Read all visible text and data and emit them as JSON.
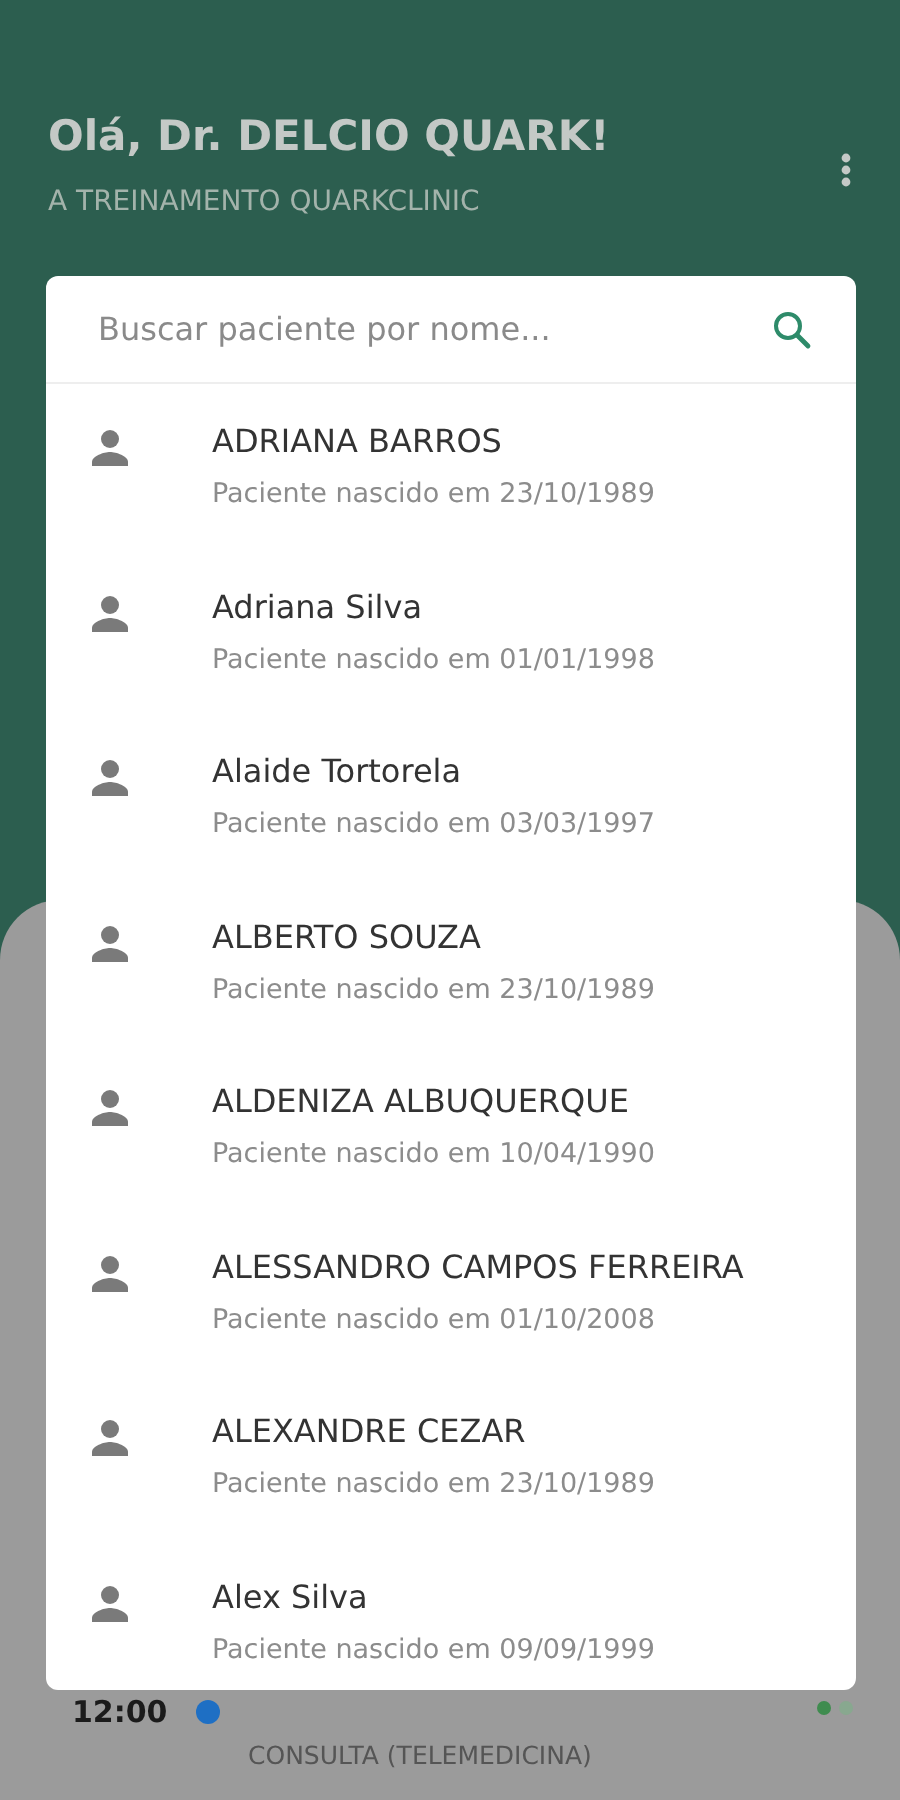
{
  "header": {
    "greeting": "Olá, Dr. DELCIO QUARK!",
    "subtitle": "A TREINAMENTO QUARKCLINIC"
  },
  "search": {
    "placeholder": "Buscar paciente por nome..."
  },
  "patients": [
    {
      "name": "ADRIANA BARROS",
      "detail": "Paciente nascido em 23/10/1989"
    },
    {
      "name": "Adriana Silva",
      "detail": "Paciente nascido em 01/01/1998"
    },
    {
      "name": "Alaide Tortorela",
      "detail": "Paciente nascido em 03/03/1997"
    },
    {
      "name": "ALBERTO SOUZA",
      "detail": "Paciente nascido em 23/10/1989"
    },
    {
      "name": "ALDENIZA ALBUQUERQUE",
      "detail": "Paciente nascido em 10/04/1990"
    },
    {
      "name": "ALESSANDRO CAMPOS FERREIRA",
      "detail": "Paciente nascido em 01/10/2008"
    },
    {
      "name": "ALEXANDRE CEZAR",
      "detail": "Paciente nascido em 23/10/1989"
    },
    {
      "name": "Alex Silva",
      "detail": "Paciente nascido em 09/09/1999"
    }
  ],
  "appointment": {
    "time": "12:00",
    "type": "CONSULTA (TELEMEDICINA)"
  }
}
